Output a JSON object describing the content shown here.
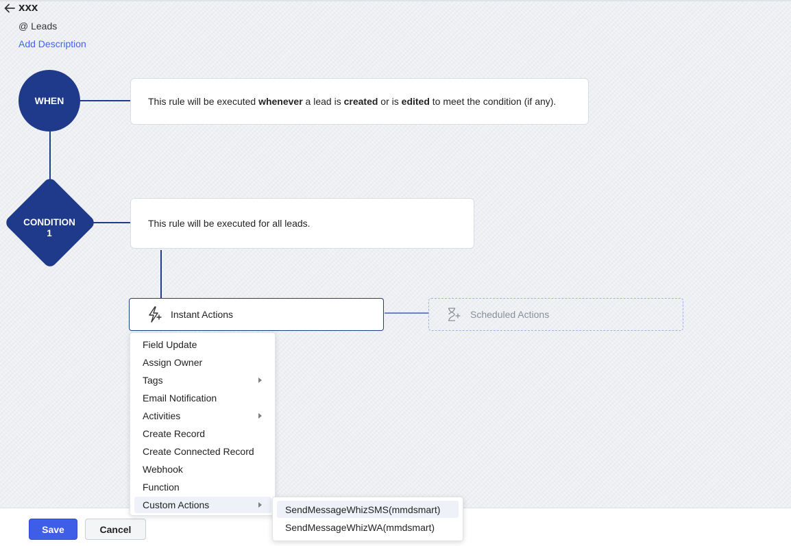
{
  "header": {
    "title": "xxx",
    "module": "@ Leads",
    "add_description": "Add Description"
  },
  "when": {
    "label": "WHEN",
    "text_1": "This rule will be executed ",
    "bold_1": "whenever",
    "text_2": " a lead is ",
    "bold_2": "created",
    "text_3": " or is ",
    "bold_3": "edited",
    "text_4": " to meet the condition (if any)."
  },
  "condition": {
    "label_line1": "CONDITION",
    "label_line2": "1",
    "text": "This rule will be executed for all leads."
  },
  "actions": {
    "instant_label": "Instant Actions",
    "scheduled_label": "Scheduled Actions"
  },
  "menu": {
    "items": [
      {
        "label": "Field Update"
      },
      {
        "label": "Assign Owner"
      },
      {
        "label": "Tags"
      },
      {
        "label": "Email Notification"
      },
      {
        "label": "Activities"
      },
      {
        "label": "Create Record"
      },
      {
        "label": "Create Connected Record"
      },
      {
        "label": "Webhook"
      },
      {
        "label": "Function"
      },
      {
        "label": "Custom Actions"
      }
    ],
    "submenu": [
      {
        "label": "SendMessageWhizSMS(mmdsmart)"
      },
      {
        "label": "SendMessageWhizWA(mmdsmart)"
      }
    ]
  },
  "footer": {
    "save_label": "Save",
    "cancel_label": "Cancel"
  },
  "colors": {
    "primary": "#1f3a8a",
    "accent_blue": "#3f64f3",
    "save_button": "#3f5ee8"
  }
}
